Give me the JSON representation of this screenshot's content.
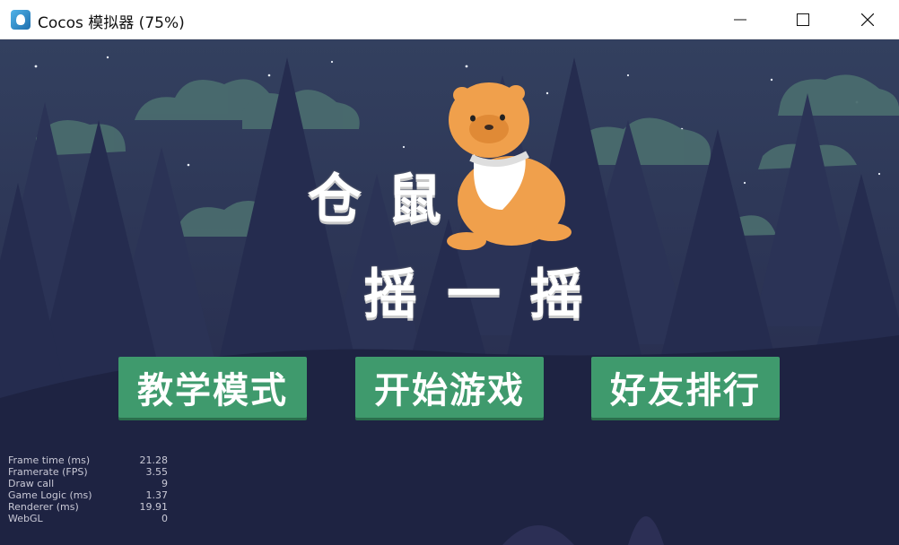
{
  "window": {
    "title": "Cocos 模拟器 (75%)",
    "icon": "cocos-app-icon",
    "controls": [
      "minimize-icon",
      "maximize-icon",
      "close-icon"
    ]
  },
  "game": {
    "title_line1": [
      "仓",
      "鼠"
    ],
    "title_line2": [
      "摇",
      "一",
      "摇"
    ],
    "mascot": "hamster-mascot",
    "buttons": {
      "tutorial": "教学模式",
      "start": "开始游戏",
      "ranking": "好友排行"
    },
    "colors": {
      "button_bg": "#3f9a6d",
      "sky": "#2c3458",
      "tree": "#232a4c",
      "hamster": "#f0a04c"
    }
  },
  "stats": [
    {
      "label": "Frame time (ms)",
      "value": "21.28"
    },
    {
      "label": "Framerate (FPS)",
      "value": "3.55"
    },
    {
      "label": "Draw call",
      "value": "9"
    },
    {
      "label": "Game Logic (ms)",
      "value": "1.37"
    },
    {
      "label": "Renderer (ms)",
      "value": "19.91"
    },
    {
      "label": "WebGL",
      "value": "0"
    }
  ]
}
